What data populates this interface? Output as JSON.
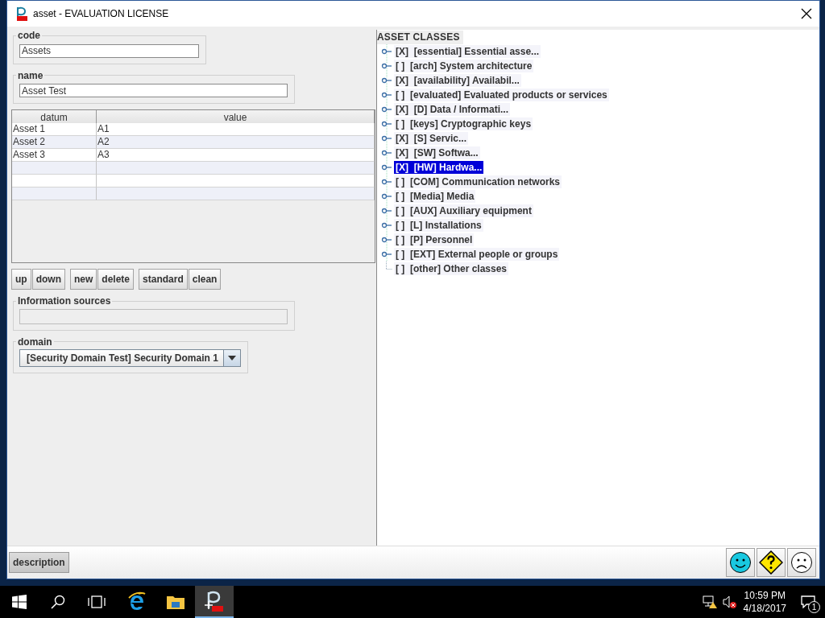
{
  "window": {
    "title": "asset - EVALUATION LICENSE"
  },
  "code": {
    "label": "code",
    "value": "Assets"
  },
  "name": {
    "label": "name",
    "value": "Asset Test"
  },
  "table": {
    "columns": [
      "datum",
      "value"
    ],
    "rows": [
      [
        "Asset 1",
        "A1"
      ],
      [
        "Asset 2",
        "A2"
      ],
      [
        "Asset 3",
        "A3"
      ]
    ]
  },
  "buttons": [
    [
      "up",
      "down"
    ],
    [
      "new",
      "delete"
    ],
    [
      "standard",
      "clean"
    ]
  ],
  "information_sources": {
    "label": "Information sources",
    "disabled": true
  },
  "domain": {
    "label": "domain",
    "value": "[Security Domain Test] Security Domain 1"
  },
  "tree": {
    "title": "ASSET CLASSES",
    "items": [
      {
        "kind": "node",
        "check": "[X]",
        "label": "[essential] Essential asse...",
        "selected": false
      },
      {
        "kind": "node",
        "check": "[ ]",
        "label": "[arch] System architecture",
        "selected": false
      },
      {
        "kind": "node",
        "check": "[X]",
        "label": "[availability] Availabil...",
        "selected": false
      },
      {
        "kind": "node",
        "check": "[ ]",
        "label": "[evaluated] Evaluated products or services",
        "selected": false
      },
      {
        "kind": "node",
        "check": "[X]",
        "label": "[D] Data / Informati...",
        "selected": false
      },
      {
        "kind": "node",
        "check": "[ ]",
        "label": "[keys] Cryptographic keys",
        "selected": false
      },
      {
        "kind": "node",
        "check": "[X]",
        "label": "[S] Servic...",
        "selected": false
      },
      {
        "kind": "node",
        "check": "[X]",
        "label": "[SW] Softwa...",
        "selected": false
      },
      {
        "kind": "node",
        "check": "[X]",
        "label": "[HW] Hardwa...",
        "selected": true
      },
      {
        "kind": "node",
        "check": "[ ]",
        "label": "[COM] Communication networks",
        "selected": false
      },
      {
        "kind": "node",
        "check": "[ ]",
        "label": "[Media] Media",
        "selected": false
      },
      {
        "kind": "node",
        "check": "[ ]",
        "label": "[AUX] Auxiliary equipment",
        "selected": false
      },
      {
        "kind": "node",
        "check": "[ ]",
        "label": "[L] Installations",
        "selected": false
      },
      {
        "kind": "node",
        "check": "[ ]",
        "label": "[P] Personnel",
        "selected": false
      },
      {
        "kind": "node",
        "check": "[ ]",
        "label": "[EXT] External people or groups",
        "selected": false
      },
      {
        "kind": "leaf",
        "check": "[ ]",
        "label": "[other] Other classes",
        "selected": false
      }
    ]
  },
  "bottom_bar": {
    "description_button": "description"
  },
  "taskbar": {
    "time": "10:59 PM",
    "date": "4/18/2017",
    "notifications": "1"
  }
}
